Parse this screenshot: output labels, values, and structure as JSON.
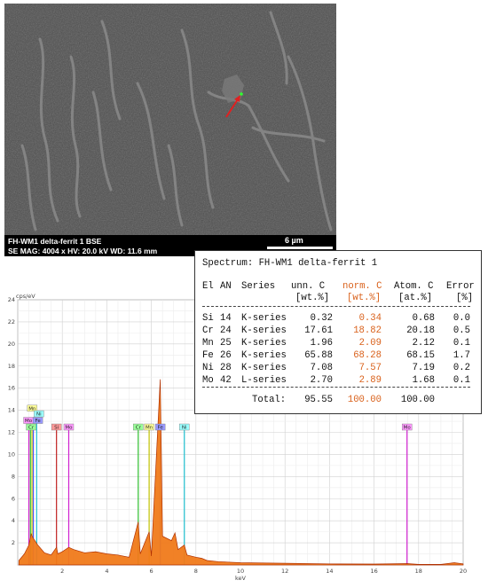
{
  "sem": {
    "caption_line1": "FH-WM1 delta-ferrit 1  BSE",
    "caption_line2": "SE  MAG: 4004 x  HV: 20.0 kV  WD: 11.6 mm",
    "scale_label": "6 µm"
  },
  "table": {
    "title": "Spectrum: FH-WM1 delta-ferrit 1",
    "headers": [
      "El",
      "AN",
      "Series",
      "unn. C",
      "norm. C",
      "Atom. C",
      "Error"
    ],
    "units": [
      "[wt.%]",
      "[wt.%]",
      "[at.%]",
      "[%]"
    ],
    "rows": [
      {
        "el": "Si",
        "an": "14",
        "series": "K-series",
        "unn": "0.32",
        "norm": "0.34",
        "atom": "0.68",
        "err": "0.0"
      },
      {
        "el": "Cr",
        "an": "24",
        "series": "K-series",
        "unn": "17.61",
        "norm": "18.82",
        "atom": "20.18",
        "err": "0.5"
      },
      {
        "el": "Mn",
        "an": "25",
        "series": "K-series",
        "unn": "1.96",
        "norm": "2.09",
        "atom": "2.12",
        "err": "0.1"
      },
      {
        "el": "Fe",
        "an": "26",
        "series": "K-series",
        "unn": "65.88",
        "norm": "68.28",
        "atom": "68.15",
        "err": "1.7"
      },
      {
        "el": "Ni",
        "an": "28",
        "series": "K-series",
        "unn": "7.08",
        "norm": "7.57",
        "atom": "7.19",
        "err": "0.2"
      },
      {
        "el": "Mo",
        "an": "42",
        "series": "L-series",
        "unn": "2.70",
        "norm": "2.89",
        "atom": "1.68",
        "err": "0.1"
      }
    ],
    "total": {
      "label": "Total:",
      "unn": "95.55",
      "norm": "100.00",
      "atom": "100.00"
    }
  },
  "chart_data": {
    "type": "line",
    "ylabel": "cps/eV",
    "xlabel": "keV",
    "xlim": [
      0,
      20
    ],
    "ylim": [
      0,
      24
    ],
    "x_ticks": [
      "2",
      "4",
      "6",
      "8",
      "10",
      "12",
      "14",
      "16",
      "18",
      "20"
    ],
    "y_ticks": [
      "2",
      "4",
      "6",
      "8",
      "10",
      "12",
      "14",
      "16",
      "18",
      "20",
      "22",
      "24"
    ],
    "grid": true,
    "series": [
      {
        "x": [
          0.05,
          0.3,
          0.5,
          0.6,
          0.7,
          0.9,
          1.2,
          1.5,
          1.74,
          1.8,
          2.0,
          2.29,
          2.5,
          3.0,
          3.5,
          4.0,
          4.5,
          5.0,
          5.41,
          5.5,
          5.9,
          6.0,
          6.4,
          6.5,
          6.9,
          7.06,
          7.2,
          7.48,
          7.6,
          8.0,
          8.26,
          8.5,
          9.0,
          10.0,
          12.0,
          14.0,
          16.0,
          17.5,
          18.0,
          19.0,
          19.6,
          20.0
        ],
        "y": [
          0.4,
          1.0,
          1.8,
          2.8,
          2.4,
          1.8,
          1.1,
          0.9,
          1.6,
          1.0,
          1.2,
          1.6,
          1.4,
          1.1,
          1.2,
          1.0,
          0.9,
          0.7,
          3.9,
          1.0,
          3.0,
          0.8,
          16.8,
          2.6,
          2.2,
          2.9,
          1.4,
          1.8,
          0.9,
          0.7,
          0.6,
          0.4,
          0.3,
          0.2,
          0.15,
          0.1,
          0.08,
          0.12,
          0.05,
          0.05,
          0.2,
          0.1
        ]
      }
    ],
    "element_lines": [
      {
        "el": "Mo",
        "x": 0.5,
        "y": 12.2,
        "color": "#d020d0"
      },
      {
        "el": "Cr",
        "x": 0.57,
        "y": 12.8,
        "color": "#30c030"
      },
      {
        "el": "Mn",
        "x": 0.64,
        "y": 12.4,
        "color": "#c0c000"
      },
      {
        "el": "Fe",
        "x": 0.7,
        "y": 12.6,
        "color": "#5050ff"
      },
      {
        "el": "Ni",
        "x": 0.85,
        "y": 13.0,
        "color": "#20c0d0"
      },
      {
        "el": "Si",
        "x": 1.74,
        "y": 12.2,
        "color": "#c02020"
      },
      {
        "el": "Mo",
        "x": 2.29,
        "y": 12.2,
        "color": "#d020d0"
      },
      {
        "el": "Cr",
        "x": 5.41,
        "y": 12.2,
        "color": "#30c030"
      },
      {
        "el": "Mn",
        "x": 5.9,
        "y": 12.2,
        "color": "#c0c000"
      },
      {
        "el": "Fe",
        "x": 6.4,
        "y": 12.2,
        "color": "#5050ff"
      },
      {
        "el": "Ni",
        "x": 7.48,
        "y": 12.2,
        "color": "#20c0d0"
      },
      {
        "el": "Mo",
        "x": 17.48,
        "y": 12.2,
        "color": "#d020d0"
      }
    ],
    "tags": [
      {
        "label": "Mn",
        "x": 0.65,
        "y": 13.9,
        "color": "#ffff99"
      },
      {
        "label": "Ni",
        "x": 0.95,
        "y": 13.4,
        "color": "#99ffff"
      },
      {
        "label": "Mo",
        "x": 0.48,
        "y": 12.8,
        "color": "#ff99ff"
      },
      {
        "label": "Fe",
        "x": 0.9,
        "y": 12.8,
        "color": "#9999ff"
      },
      {
        "label": "Cr",
        "x": 0.6,
        "y": 12.2,
        "color": "#99ff99"
      },
      {
        "label": "Si",
        "x": 1.74,
        "y": 12.2,
        "color": "#ff9999"
      },
      {
        "label": "Mo",
        "x": 2.29,
        "y": 12.2,
        "color": "#ff99ff"
      },
      {
        "label": "Cr",
        "x": 5.41,
        "y": 12.2,
        "color": "#99ff99"
      },
      {
        "label": "Mn",
        "x": 5.9,
        "y": 12.2,
        "color": "#ffff99"
      },
      {
        "label": "Fe",
        "x": 6.4,
        "y": 12.2,
        "color": "#9999ff"
      },
      {
        "label": "Ni",
        "x": 7.48,
        "y": 12.2,
        "color": "#99ffff"
      },
      {
        "label": "Mo",
        "x": 17.48,
        "y": 12.2,
        "color": "#ff99ff"
      }
    ],
    "colors": {
      "spectrum": "#f07a1a",
      "peak_stroke": "#b03000"
    }
  }
}
